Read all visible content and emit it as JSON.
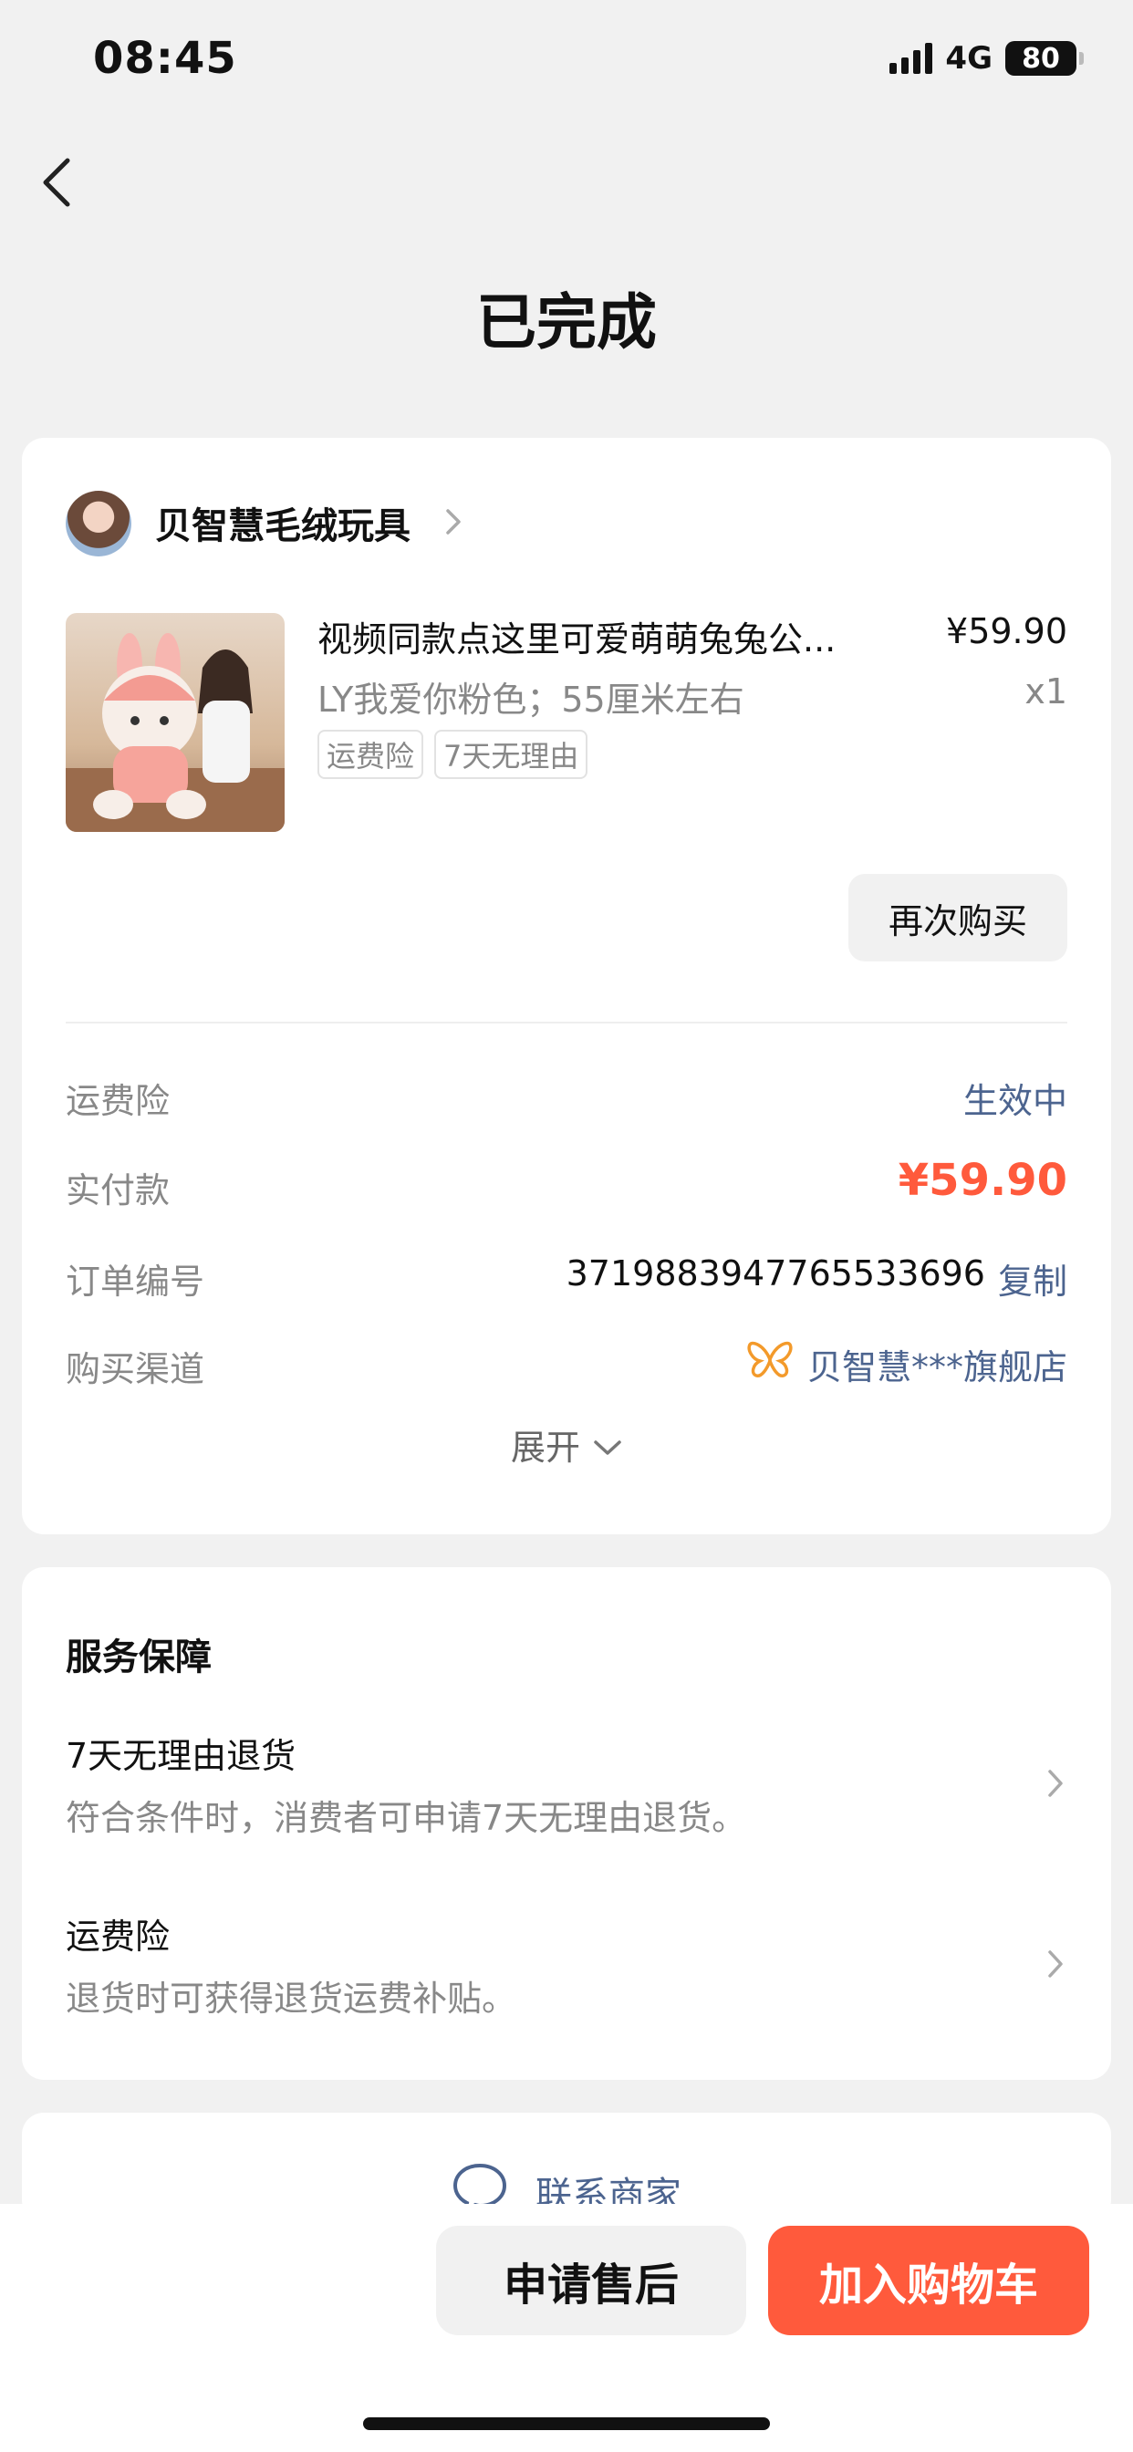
{
  "status_bar": {
    "time": "08:45",
    "network": "4G",
    "battery": "80"
  },
  "header": {
    "title": "已完成"
  },
  "shop": {
    "name": "贝智慧毛绒玩具"
  },
  "product": {
    "title": "视频同款点这里可爱萌萌兔兔公...",
    "price": "¥59.90",
    "spec": "LY我爱你粉色；55厘米左右",
    "qty": "x1",
    "tags": [
      "运费险",
      "7天无理由"
    ],
    "rebuy_label": "再次购买"
  },
  "order_info": {
    "shipping_insurance_label": "运费险",
    "shipping_insurance_value": "生效中",
    "paid_label": "实付款",
    "paid_value": "¥59.90",
    "order_no_label": "订单编号",
    "order_no_value": "3719883947765533696",
    "copy_label": "复制",
    "channel_label": "购买渠道",
    "channel_value": "贝智慧***旗舰店",
    "expand_label": "展开"
  },
  "services": {
    "title": "服务保障",
    "items": [
      {
        "title": "7天无理由退货",
        "desc": "符合条件时，消费者可申请7天无理由退货。"
      },
      {
        "title": "运费险",
        "desc": "退货时可获得退货运费补贴。"
      }
    ]
  },
  "contact": {
    "label": "联系商家"
  },
  "bottom_bar": {
    "after_sale_label": "申请售后",
    "add_cart_label": "加入购物车"
  },
  "colors": {
    "accent": "#ff5a3c",
    "link": "#4c648f",
    "background": "#f1f1f1"
  }
}
